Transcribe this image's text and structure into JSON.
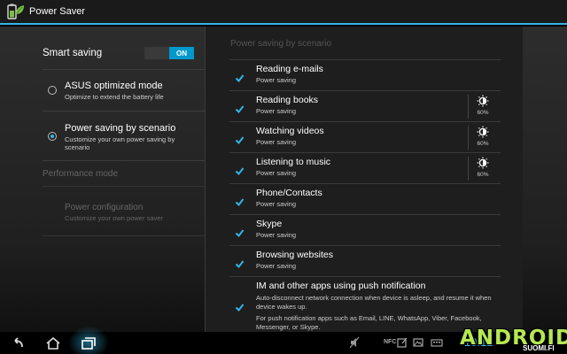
{
  "titlebar": {
    "title": "Power Saver",
    "icon": "battery-leaf-icon"
  },
  "left": {
    "smart_saving": {
      "label": "Smart saving",
      "toggle": "ON"
    },
    "options": [
      {
        "title": "ASUS optimized mode",
        "subtitle": "Optimize to extend the battery life",
        "selected": false
      },
      {
        "title": "Power saving by scenario",
        "subtitle": "Customize your own power saving by scenario",
        "selected": true
      }
    ],
    "performance_header": "Performance mode",
    "power_config": {
      "title": "Power configuration",
      "subtitle": "Customize your own power saver"
    }
  },
  "right": {
    "header": "Power saving by scenario",
    "scenarios": [
      {
        "title": "Reading e-mails",
        "subtitle": "Power saving",
        "checked": true,
        "brightness": ""
      },
      {
        "title": "Reading books",
        "subtitle": "Power saving",
        "checked": true,
        "brightness": "60%"
      },
      {
        "title": "Watching videos",
        "subtitle": "Power saving",
        "checked": true,
        "brightness": "60%"
      },
      {
        "title": "Listening to music",
        "subtitle": "Power saving",
        "checked": true,
        "brightness": "60%"
      },
      {
        "title": "Phone/Contacts",
        "subtitle": "Power saving",
        "checked": true,
        "brightness": ""
      },
      {
        "title": "Skype",
        "subtitle": "Power saving",
        "checked": true,
        "brightness": ""
      },
      {
        "title": "Browsing websites",
        "subtitle": "Power saving",
        "checked": true,
        "brightness": ""
      }
    ],
    "im_row": {
      "title": "IM and other apps using push notification",
      "desc": "Auto-disconnect network connection when device is asleep, and resume it when device wakes up.",
      "desc2": "For push notification apps such as Email, LINE, WhatsApp, Viber, Facebook, Messenger, or Skype.",
      "checked": true
    }
  },
  "navbar": {
    "nfc": "NFC",
    "clock": "10:12"
  },
  "watermark": {
    "main": "ANDROID",
    "sub": "SUOMI.FI"
  },
  "colors": {
    "accent": "#33b5e5",
    "toggle_on": "#0099cc",
    "logo_green": "#b5e853"
  }
}
